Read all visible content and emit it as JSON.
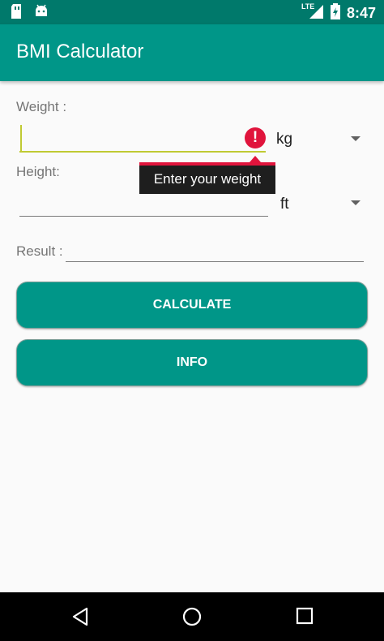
{
  "status_bar": {
    "time": "8:47",
    "network": "LTE",
    "icons": [
      "sd-card-icon",
      "android-debug-icon",
      "signal-icon",
      "battery-charging-icon"
    ]
  },
  "app_bar": {
    "title": "BMI Calculator"
  },
  "weight": {
    "label": "Weight :",
    "value": "",
    "unit": "kg",
    "error_tooltip": "Enter your weight"
  },
  "height": {
    "label": "Height:",
    "value": "",
    "unit": "ft"
  },
  "result": {
    "label": "Result :",
    "value": ""
  },
  "buttons": {
    "calculate": "CALCULATE",
    "info": "INFO"
  },
  "colors": {
    "primary": "#009688",
    "primary_dark": "#00796b",
    "error": "#e0143c",
    "accent_line": "#c0ca33"
  },
  "nav": {
    "icons": [
      "back-icon",
      "home-icon",
      "recents-icon"
    ]
  }
}
